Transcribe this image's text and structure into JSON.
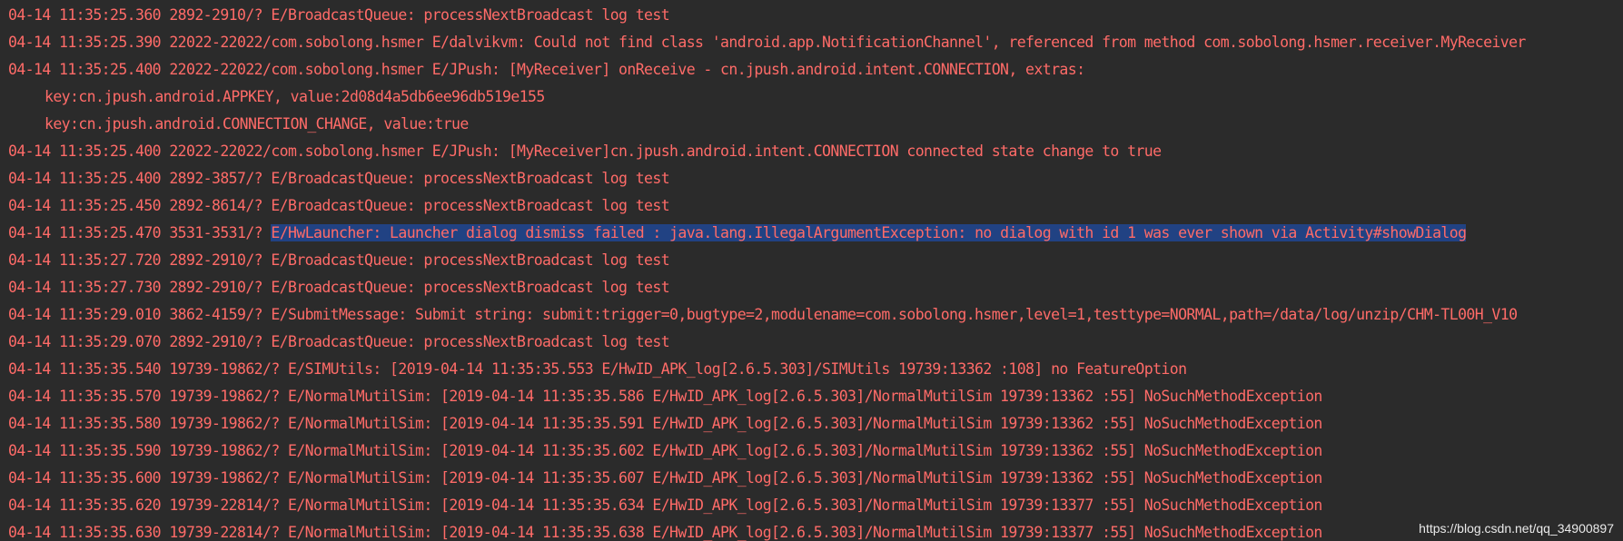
{
  "logcat": {
    "lines": [
      {
        "text": "04-14 11:35:25.360 2892-2910/? E/BroadcastQueue: processNextBroadcast log test"
      },
      {
        "text": "04-14 11:35:25.390 22022-22022/com.sobolong.hsmer E/dalvikvm: Could not find class 'android.app.NotificationChannel', referenced from method com.sobolong.hsmer.receiver.MyReceiver"
      },
      {
        "text": "04-14 11:35:25.400 22022-22022/com.sobolong.hsmer E/JPush: [MyReceiver] onReceive - cn.jpush.android.intent.CONNECTION, extras:"
      },
      {
        "text": "key:cn.jpush.android.APPKEY, value:2d08d4a5db6ee96db519e155"
      },
      {
        "text": "key:cn.jpush.android.CONNECTION_CHANGE, value:true"
      },
      {
        "text": "04-14 11:35:25.400 22022-22022/com.sobolong.hsmer E/JPush: [MyReceiver]cn.jpush.android.intent.CONNECTION connected state change to true"
      },
      {
        "text": "04-14 11:35:25.400 2892-3857/? E/BroadcastQueue: processNextBroadcast log test"
      },
      {
        "text": "04-14 11:35:25.450 2892-8614/? E/BroadcastQueue: processNextBroadcast log test"
      },
      {
        "prefix": "04-14 11:35:25.470 3531-3531/? ",
        "highlighted": "E/HwLauncher: Launcher dialog dismiss failed : java.lang.IllegalArgumentException: no dialog with id 1 was ever shown via Activity#showDialog"
      },
      {
        "text": "04-14 11:35:27.720 2892-2910/? E/BroadcastQueue: processNextBroadcast log test"
      },
      {
        "text": "04-14 11:35:27.730 2892-2910/? E/BroadcastQueue: processNextBroadcast log test"
      },
      {
        "text": "04-14 11:35:29.010 3862-4159/? E/SubmitMessage: Submit string: submit:trigger=0,bugtype=2,modulename=com.sobolong.hsmer,level=1,testtype=NORMAL,path=/data/log/unzip/CHM-TL00H_V10"
      },
      {
        "text": "04-14 11:35:29.070 2892-2910/? E/BroadcastQueue: processNextBroadcast log test"
      },
      {
        "text": "04-14 11:35:35.540 19739-19862/? E/SIMUtils: [2019-04-14 11:35:35.553 E/HwID_APK_log[2.6.5.303]/SIMUtils 19739:13362 :108] no FeatureOption"
      },
      {
        "text": "04-14 11:35:35.570 19739-19862/? E/NormalMutilSim: [2019-04-14 11:35:35.586 E/HwID_APK_log[2.6.5.303]/NormalMutilSim 19739:13362 :55] NoSuchMethodException"
      },
      {
        "text": "04-14 11:35:35.580 19739-19862/? E/NormalMutilSim: [2019-04-14 11:35:35.591 E/HwID_APK_log[2.6.5.303]/NormalMutilSim 19739:13362 :55] NoSuchMethodException"
      },
      {
        "text": "04-14 11:35:35.590 19739-19862/? E/NormalMutilSim: [2019-04-14 11:35:35.602 E/HwID_APK_log[2.6.5.303]/NormalMutilSim 19739:13362 :55] NoSuchMethodException"
      },
      {
        "text": "04-14 11:35:35.600 19739-19862/? E/NormalMutilSim: [2019-04-14 11:35:35.607 E/HwID_APK_log[2.6.5.303]/NormalMutilSim 19739:13362 :55] NoSuchMethodException"
      },
      {
        "text": "04-14 11:35:35.620 19739-22814/? E/NormalMutilSim: [2019-04-14 11:35:35.634 E/HwID_APK_log[2.6.5.303]/NormalMutilSim 19739:13377 :55] NoSuchMethodException"
      },
      {
        "text": "04-14 11:35:35.630 19739-22814/? E/NormalMutilSim: [2019-04-14 11:35:35.638 E/HwID_APK_log[2.6.5.303]/NormalMutilSim 19739:13377 :55] NoSuchMethodException"
      }
    ]
  },
  "watermark": "https://blog.csdn.net/qq_34900897",
  "colors": {
    "background": "#2b2b2b",
    "error_text": "#ff6b68",
    "selection": "#214283"
  }
}
